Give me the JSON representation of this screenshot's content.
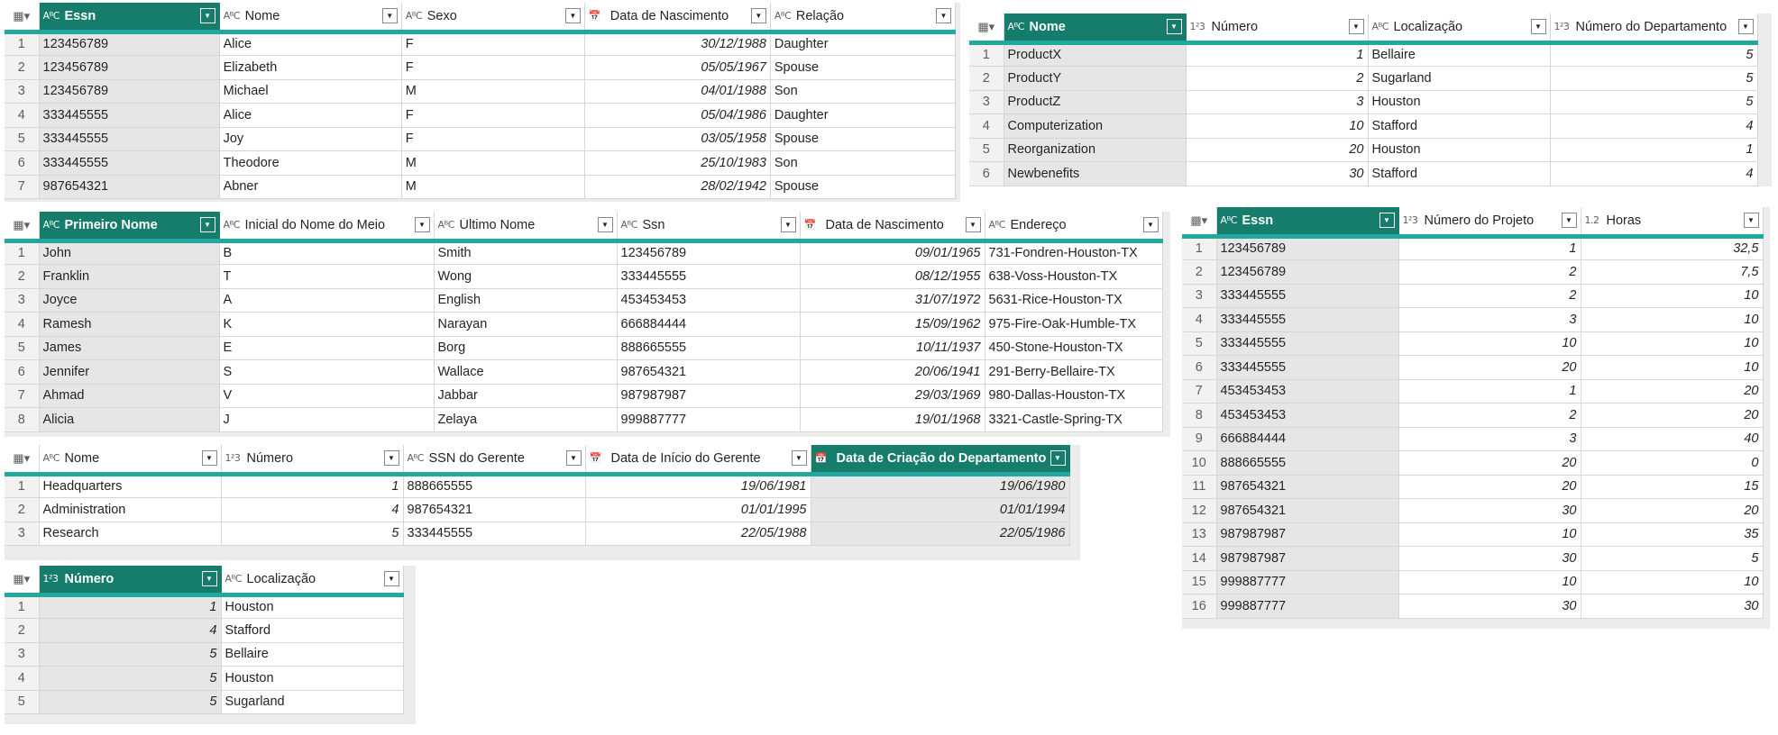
{
  "tables": [
    {
      "id": "dependentes",
      "columns": [
        {
          "label": "Essn",
          "type": "text",
          "icon": "abc-text-icon",
          "selected": true
        },
        {
          "label": "Nome",
          "type": "text",
          "icon": "abc-text-icon"
        },
        {
          "label": "Sexo",
          "type": "text",
          "icon": "abc-text-icon"
        },
        {
          "label": "Data de Nascimento",
          "type": "date",
          "icon": "calendar-icon"
        },
        {
          "label": "Relação",
          "type": "text",
          "icon": "abc-text-icon"
        }
      ],
      "rows": [
        [
          "123456789",
          "Alice",
          "F",
          "30/12/1988",
          "Daughter"
        ],
        [
          "123456789",
          "Elizabeth",
          "F",
          "05/05/1967",
          "Spouse"
        ],
        [
          "123456789",
          "Michael",
          "M",
          "04/01/1988",
          "Son"
        ],
        [
          "333445555",
          "Alice",
          "F",
          "05/04/1986",
          "Daughter"
        ],
        [
          "333445555",
          "Joy",
          "F",
          "03/05/1958",
          "Spouse"
        ],
        [
          "333445555",
          "Theodore",
          "M",
          "25/10/1983",
          "Son"
        ],
        [
          "987654321",
          "Abner",
          "M",
          "28/02/1942",
          "Spouse"
        ]
      ]
    },
    {
      "id": "projetos",
      "columns": [
        {
          "label": "Nome",
          "type": "text",
          "icon": "abc-text-icon",
          "selected": true
        },
        {
          "label": "Número",
          "type": "int",
          "icon": "123-number-icon"
        },
        {
          "label": "Localização",
          "type": "text",
          "icon": "abc-text-icon"
        },
        {
          "label": "Número do Departamento",
          "type": "int",
          "icon": "123-number-icon"
        }
      ],
      "rows": [
        [
          "ProductX",
          "1",
          "Bellaire",
          "5"
        ],
        [
          "ProductY",
          "2",
          "Sugarland",
          "5"
        ],
        [
          "ProductZ",
          "3",
          "Houston",
          "5"
        ],
        [
          "Computerization",
          "10",
          "Stafford",
          "4"
        ],
        [
          "Reorganization",
          "20",
          "Houston",
          "1"
        ],
        [
          "Newbenefits",
          "30",
          "Stafford",
          "4"
        ]
      ]
    },
    {
      "id": "funcionarios",
      "columns": [
        {
          "label": "Primeiro Nome",
          "type": "text",
          "icon": "abc-text-icon",
          "selected": true
        },
        {
          "label": "Inicial do Nome do Meio",
          "type": "text",
          "icon": "abc-text-icon"
        },
        {
          "label": "Último Nome",
          "type": "text",
          "icon": "abc-text-icon"
        },
        {
          "label": "Ssn",
          "type": "text",
          "icon": "abc-text-icon"
        },
        {
          "label": "Data de Nascimento",
          "type": "date",
          "icon": "calendar-icon"
        },
        {
          "label": "Endereço",
          "type": "text",
          "icon": "abc-text-icon"
        }
      ],
      "rows": [
        [
          "John",
          "B",
          "Smith",
          "123456789",
          "09/01/1965",
          "731-Fondren-Houston-TX"
        ],
        [
          "Franklin",
          "T",
          "Wong",
          "333445555",
          "08/12/1955",
          "638-Voss-Houston-TX"
        ],
        [
          "Joyce",
          "A",
          "English",
          "453453453",
          "31/07/1972",
          "5631-Rice-Houston-TX"
        ],
        [
          "Ramesh",
          "K",
          "Narayan",
          "666884444",
          "15/09/1962",
          "975-Fire-Oak-Humble-TX"
        ],
        [
          "James",
          "E",
          "Borg",
          "888665555",
          "10/11/1937",
          "450-Stone-Houston-TX"
        ],
        [
          "Jennifer",
          "S",
          "Wallace",
          "987654321",
          "20/06/1941",
          "291-Berry-Bellaire-TX"
        ],
        [
          "Ahmad",
          "V",
          "Jabbar",
          "987987987",
          "29/03/1969",
          "980-Dallas-Houston-TX"
        ],
        [
          "Alicia",
          "J",
          "Zelaya",
          "999887777",
          "19/01/1968",
          "3321-Castle-Spring-TX"
        ]
      ]
    },
    {
      "id": "trabalha_em",
      "columns": [
        {
          "label": "Essn",
          "type": "text",
          "icon": "abc-text-icon",
          "selected": true
        },
        {
          "label": "Número do Projeto",
          "type": "int",
          "icon": "123-number-icon"
        },
        {
          "label": "Horas",
          "type": "decimal",
          "icon": "decimal-number-icon"
        }
      ],
      "rows": [
        [
          "123456789",
          "1",
          "32,5"
        ],
        [
          "123456789",
          "2",
          "7,5"
        ],
        [
          "333445555",
          "2",
          "10"
        ],
        [
          "333445555",
          "3",
          "10"
        ],
        [
          "333445555",
          "10",
          "10"
        ],
        [
          "333445555",
          "20",
          "10"
        ],
        [
          "453453453",
          "1",
          "20"
        ],
        [
          "453453453",
          "2",
          "20"
        ],
        [
          "666884444",
          "3",
          "40"
        ],
        [
          "888665555",
          "20",
          "0"
        ],
        [
          "987654321",
          "20",
          "15"
        ],
        [
          "987654321",
          "30",
          "20"
        ],
        [
          "987987987",
          "10",
          "35"
        ],
        [
          "987987987",
          "30",
          "5"
        ],
        [
          "999887777",
          "10",
          "10"
        ],
        [
          "999887777",
          "30",
          "30"
        ]
      ]
    },
    {
      "id": "departamentos",
      "columns": [
        {
          "label": "Nome",
          "type": "text",
          "icon": "abc-text-icon"
        },
        {
          "label": "Número",
          "type": "int",
          "icon": "123-number-icon"
        },
        {
          "label": "SSN do Gerente",
          "type": "text",
          "icon": "abc-text-icon"
        },
        {
          "label": "Data de Início do Gerente",
          "type": "date",
          "icon": "calendar-icon"
        },
        {
          "label": "Data de Criação do Departamento",
          "type": "date",
          "icon": "calendar-icon",
          "selected": true
        }
      ],
      "rows": [
        [
          "Headquarters",
          "1",
          "888665555",
          "19/06/1981",
          "19/06/1980"
        ],
        [
          "Administration",
          "4",
          "987654321",
          "01/01/1995",
          "01/01/1994"
        ],
        [
          "Research",
          "5",
          "333445555",
          "22/05/1988",
          "22/05/1986"
        ]
      ]
    },
    {
      "id": "localizacoes",
      "columns": [
        {
          "label": "Número",
          "type": "int",
          "icon": "123-number-icon",
          "selected": true
        },
        {
          "label": "Localização",
          "type": "text",
          "icon": "abc-text-icon"
        }
      ],
      "rows": [
        [
          "1",
          "Houston"
        ],
        [
          "4",
          "Stafford"
        ],
        [
          "5",
          "Bellaire"
        ],
        [
          "5",
          "Houston"
        ],
        [
          "5",
          "Sugarland"
        ]
      ]
    }
  ],
  "icons": {
    "abc-text-icon": "AᴮC",
    "123-number-icon": "1²3",
    "calendar-icon": "📅",
    "decimal-number-icon": "1.2",
    "table-menu-icon": "▦▾",
    "dropdown-icon": "▼"
  },
  "colors": {
    "selected_header": "#167c6b",
    "header_underline": "#22a89e"
  }
}
